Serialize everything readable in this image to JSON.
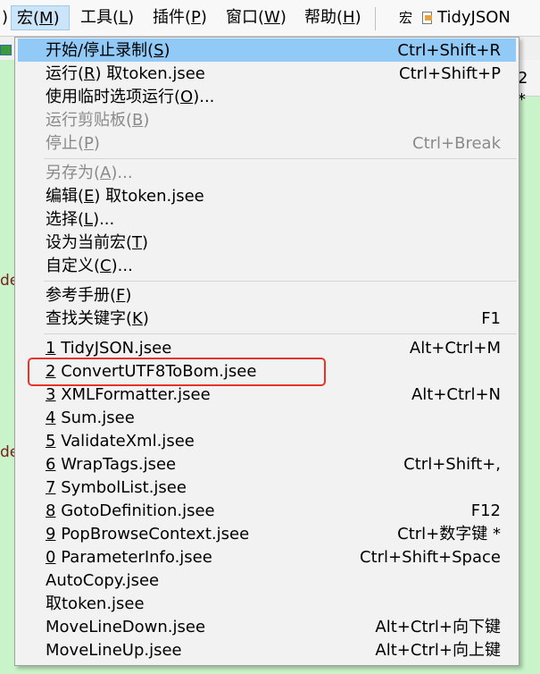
{
  "menubar": {
    "paren": ")",
    "items": [
      {
        "label": "宏(M)",
        "active": true
      },
      {
        "label": "工具(L)"
      },
      {
        "label": "插件(P)"
      },
      {
        "label": "窗口(W)"
      },
      {
        "label": "帮助(H)"
      }
    ],
    "macro_label": "宏",
    "current_macro": "TidyJSON"
  },
  "background": {
    "tab_text": "2 *",
    "edge_text_1": "de",
    "edge_text_2": "de"
  },
  "menu": {
    "record": {
      "label": "开始/停止录制(S)",
      "shortcut": "Ctrl+Shift+R"
    },
    "run": {
      "label": "运行(R)  取token.jsee",
      "shortcut": "Ctrl+Shift+P"
    },
    "run_temp": {
      "label": "使用临时选项运行(O)..."
    },
    "run_clipboard": {
      "label": "运行剪贴板(B)",
      "disabled": true
    },
    "stop": {
      "label": "停止(P)",
      "shortcut": "Ctrl+Break",
      "disabled": true
    },
    "save_as": {
      "label": "另存为(A)...",
      "disabled": true
    },
    "edit": {
      "label": "编辑(E)  取token.jsee"
    },
    "select": {
      "label": "选择(L)..."
    },
    "set_current": {
      "label": "设为当前宏(T)"
    },
    "customize": {
      "label": "自定义(C)..."
    },
    "reference": {
      "label": "参考手册(F)"
    },
    "find_keyword": {
      "label": "查找关键字(K)",
      "shortcut": "F1"
    },
    "macros": [
      {
        "num": "1",
        "name": "TidyJSON.jsee",
        "shortcut": "Alt+Ctrl+M"
      },
      {
        "num": "2",
        "name": "ConvertUTF8ToBom.jsee",
        "shortcut": ""
      },
      {
        "num": "3",
        "name": "XMLFormatter.jsee",
        "shortcut": "Alt+Ctrl+N"
      },
      {
        "num": "4",
        "name": "Sum.jsee",
        "shortcut": ""
      },
      {
        "num": "5",
        "name": "ValidateXml.jsee",
        "shortcut": ""
      },
      {
        "num": "6",
        "name": "WrapTags.jsee",
        "shortcut": "Ctrl+Shift+,"
      },
      {
        "num": "7",
        "name": "SymbolList.jsee",
        "shortcut": ""
      },
      {
        "num": "8",
        "name": "GotoDefinition.jsee",
        "shortcut": "F12"
      },
      {
        "num": "9",
        "name": "PopBrowseContext.jsee",
        "shortcut": "Ctrl+数字键 *"
      },
      {
        "num": "0",
        "name": "ParameterInfo.jsee",
        "shortcut": "Ctrl+Shift+Space"
      },
      {
        "num": "",
        "name": "AutoCopy.jsee",
        "shortcut": ""
      },
      {
        "num": "",
        "name": "取token.jsee",
        "shortcut": ""
      },
      {
        "num": "",
        "name": "MoveLineDown.jsee",
        "shortcut": "Alt+Ctrl+向下键"
      },
      {
        "num": "",
        "name": "MoveLineUp.jsee",
        "shortcut": "Alt+Ctrl+向上键"
      }
    ]
  },
  "annotation": {
    "highlight_color": "#e8332a"
  }
}
